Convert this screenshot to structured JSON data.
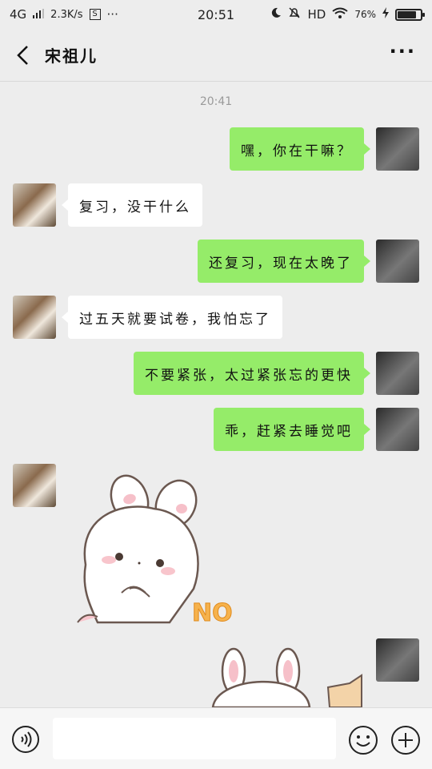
{
  "status_bar": {
    "network": "4G",
    "speed": "2.3K/s",
    "time": "20:51",
    "hd": "HD",
    "battery": "76%",
    "more_dots": "···"
  },
  "header": {
    "title": "宋祖儿",
    "back_icon": "chevron-left-icon",
    "more_label": "···"
  },
  "chat": {
    "timestamp": "20:41",
    "messages": [
      {
        "from": "me",
        "text": "嘿，你在干嘛？"
      },
      {
        "from": "other",
        "text": "复习，没干什么"
      },
      {
        "from": "me",
        "text": "还复习，现在太晚了"
      },
      {
        "from": "other",
        "text": "过五天就要试卷，我怕忘了"
      },
      {
        "from": "me",
        "text": "不要紧张，太过紧张忘的更快"
      },
      {
        "from": "me",
        "text": "乖，赶紧去睡觉吧"
      },
      {
        "from": "other",
        "type": "sticker",
        "sticker_text": "NO"
      },
      {
        "from": "me",
        "type": "sticker"
      }
    ]
  },
  "input_bar": {
    "value": "",
    "voice_icon": "voice-icon",
    "emoji_icon": "emoji-icon",
    "plus_icon": "plus-icon"
  },
  "colors": {
    "my_bubble": "#95ec69",
    "other_bubble": "#ffffff",
    "background": "#ededed"
  }
}
